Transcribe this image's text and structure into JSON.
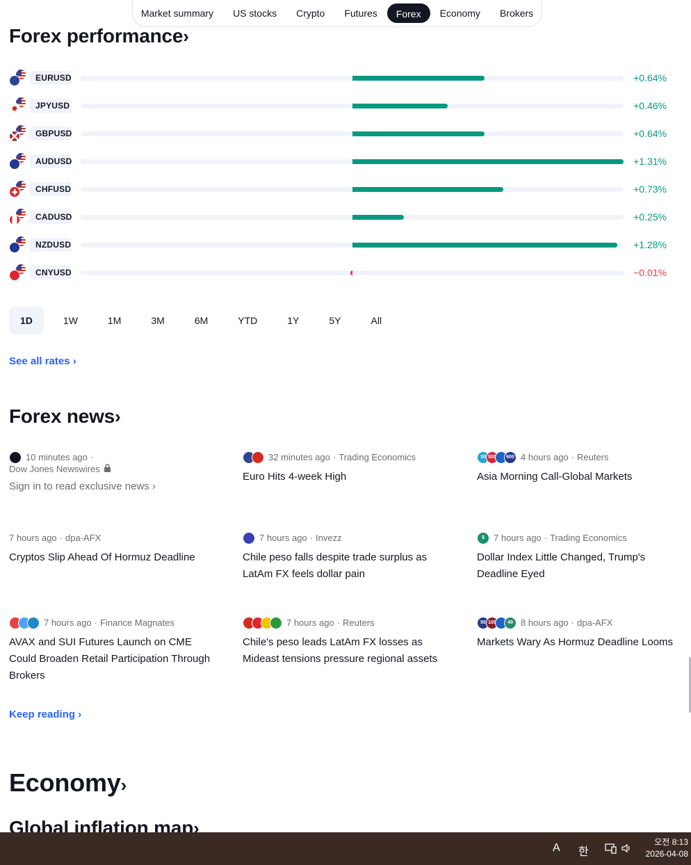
{
  "nav": {
    "tabs": [
      "Market summary",
      "US stocks",
      "Crypto",
      "Futures",
      "Forex",
      "Economy",
      "Brokers"
    ],
    "active": "Forex"
  },
  "forex_performance": {
    "title": "Forex performance",
    "chevron": "›",
    "rows": [
      {
        "pair": "EURUSD",
        "change": "+0.64%",
        "value": 0.64,
        "base_flag": "eu-flag-icon",
        "base_color": "#2e4593"
      },
      {
        "pair": "JPYUSD",
        "change": "+0.46%",
        "value": 0.46,
        "base_flag": "japan-flag-icon",
        "base_color": "#f0f0f0"
      },
      {
        "pair": "GBPUSD",
        "change": "+0.64%",
        "value": 0.64,
        "base_flag": "uk-flag-icon",
        "base_color": "#2e4593"
      },
      {
        "pair": "AUDUSD",
        "change": "+1.31%",
        "value": 1.31,
        "base_flag": "australia-flag-icon",
        "base_color": "#1f3a93"
      },
      {
        "pair": "CHFUSD",
        "change": "+0.73%",
        "value": 0.73,
        "base_flag": "switzerland-flag-icon",
        "base_color": "#e0262d"
      },
      {
        "pair": "CADUSD",
        "change": "+0.25%",
        "value": 0.25,
        "base_flag": "canada-flag-icon",
        "base_color": "#e0262d"
      },
      {
        "pair": "NZDUSD",
        "change": "+1.28%",
        "value": 1.28,
        "base_flag": "new-zealand-flag-icon",
        "base_color": "#1f3a93"
      },
      {
        "pair": "CNYUSD",
        "change": "−0.01%",
        "value": -0.01,
        "base_flag": "china-flag-icon",
        "base_color": "#e0262d"
      }
    ],
    "max_abs": 1.31,
    "colors": {
      "positive": "#089981",
      "negative": "#f23645"
    },
    "periods": [
      "1D",
      "1W",
      "1M",
      "3M",
      "6M",
      "YTD",
      "1Y",
      "5Y",
      "All"
    ],
    "active_period": "1D",
    "see_all": "See all rates ›"
  },
  "forex_news": {
    "title": "Forex news",
    "chevron": "›",
    "items": [
      {
        "time": "10 minutes ago",
        "source": "Dow Jones Newswires",
        "headline": "",
        "signin": "Sign in to read exclusive news ›",
        "icons": [
          {
            "color": "#131722",
            "label": ""
          }
        ],
        "locked": true
      },
      {
        "time": "32 minutes ago",
        "source": "Trading Economics",
        "headline": "Euro Hits 4-week High",
        "icons": [
          {
            "color": "#2e4593",
            "label": ""
          },
          {
            "color": "#d52b1e",
            "label": ""
          }
        ]
      },
      {
        "time": "4 hours ago",
        "source": "Reuters",
        "headline": "Asia Morning Call-Global Markets",
        "icons": [
          {
            "color": "#29a0d9",
            "label": "30"
          },
          {
            "color": "#d7263d",
            "label": "500"
          },
          {
            "color": "#1e63c6",
            "label": ""
          },
          {
            "color": "#233a8a",
            "label": "600"
          }
        ]
      },
      {
        "time": "7 hours ago",
        "source": "dpa-AFX",
        "headline": "Cryptos Slip Ahead Of Hormuz Deadline",
        "icons": []
      },
      {
        "time": "7 hours ago",
        "source": "Invezz",
        "headline": "Chile peso falls despite trade surplus as LatAm FX feels dollar pain",
        "icons": [
          {
            "color": "#3a3fb8",
            "label": ""
          }
        ]
      },
      {
        "time": "7 hours ago",
        "source": "Trading Economics",
        "headline": "Dollar Index Little Changed, Trump's Deadline Eyed",
        "icons": [
          {
            "color": "#1b8f6a",
            "label": "$"
          }
        ]
      },
      {
        "time": "7 hours ago",
        "source": "Finance Magnates",
        "headline": "AVAX and SUI Futures Launch on CME Could Broaden Retail Participation Through Brokers",
        "icons": [
          {
            "color": "#e84142",
            "label": ""
          },
          {
            "color": "#4da2ff",
            "label": ""
          },
          {
            "color": "#1e88c9",
            "label": ""
          }
        ]
      },
      {
        "time": "7 hours ago",
        "source": "Reuters",
        "headline": "Chile's peso leads LatAm FX losses as Mideast tensions pressure regional assets",
        "icons": [
          {
            "color": "#d52b1e",
            "label": ""
          },
          {
            "color": "#e0262d",
            "label": ""
          },
          {
            "color": "#f5c400",
            "label": ""
          },
          {
            "color": "#2a9a3c",
            "label": ""
          }
        ]
      },
      {
        "time": "8 hours ago",
        "source": "dpa-AFX",
        "headline": "Markets Wary As Hormuz Deadline Looms",
        "icons": [
          {
            "color": "#233a8a",
            "label": "50"
          },
          {
            "color": "#8b1c2c",
            "label": "100"
          },
          {
            "color": "#1e63c6",
            "label": ""
          },
          {
            "color": "#2a8c6c",
            "label": "40"
          }
        ]
      }
    ],
    "keep_reading": "Keep reading ›"
  },
  "economy": {
    "title": "Economy",
    "chevron": "›",
    "subtitle": "Global inflation map",
    "subtitle_chevron": "›"
  },
  "taskbar": {
    "ime_a": "A",
    "ime_han": "한",
    "time": "오전 8:13",
    "date": "2026-04-08"
  }
}
